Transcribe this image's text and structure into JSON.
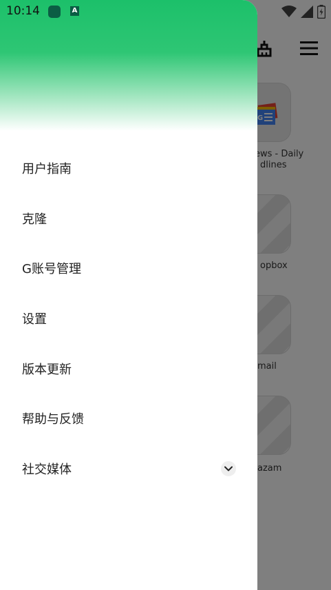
{
  "status_bar": {
    "time": "10:14",
    "icons": [
      "app-notification-icon",
      "a-notification-icon",
      "wifi-icon",
      "signal-icon",
      "battery-icon"
    ]
  },
  "background_app": {
    "toolbar_icons": [
      "cleaner-icon",
      "hamburger-menu-icon"
    ],
    "cards": [
      {
        "label": "Google News - Daily Headlines",
        "visible_label_line1": "ews - Daily",
        "visible_label_line2": "dlines",
        "icon": "google-news-icon"
      },
      {
        "label": "Dropbox",
        "visible_label_line1": "opbox",
        "icon": "placeholder-app-icon"
      },
      {
        "label": "Gmail",
        "visible_label_line1": "mail",
        "icon": "placeholder-app-icon"
      },
      {
        "label": "Shazam",
        "visible_label_line1": "azam",
        "icon": "placeholder-app-icon"
      }
    ]
  },
  "drawer": {
    "header_gradient": [
      "#1cc06a",
      "#ffffff"
    ],
    "items": [
      {
        "label": "用户指南"
      },
      {
        "label": "克隆"
      },
      {
        "label": "G账号管理"
      },
      {
        "label": "设置"
      },
      {
        "label": "版本更新"
      },
      {
        "label": "帮助与反馈"
      },
      {
        "label": "社交媒体",
        "expandable": true,
        "icon": "chevron-down-icon"
      }
    ]
  },
  "colors": {
    "accent": "#1cc06a",
    "scrim": "rgba(0,0,0,0.5)"
  }
}
